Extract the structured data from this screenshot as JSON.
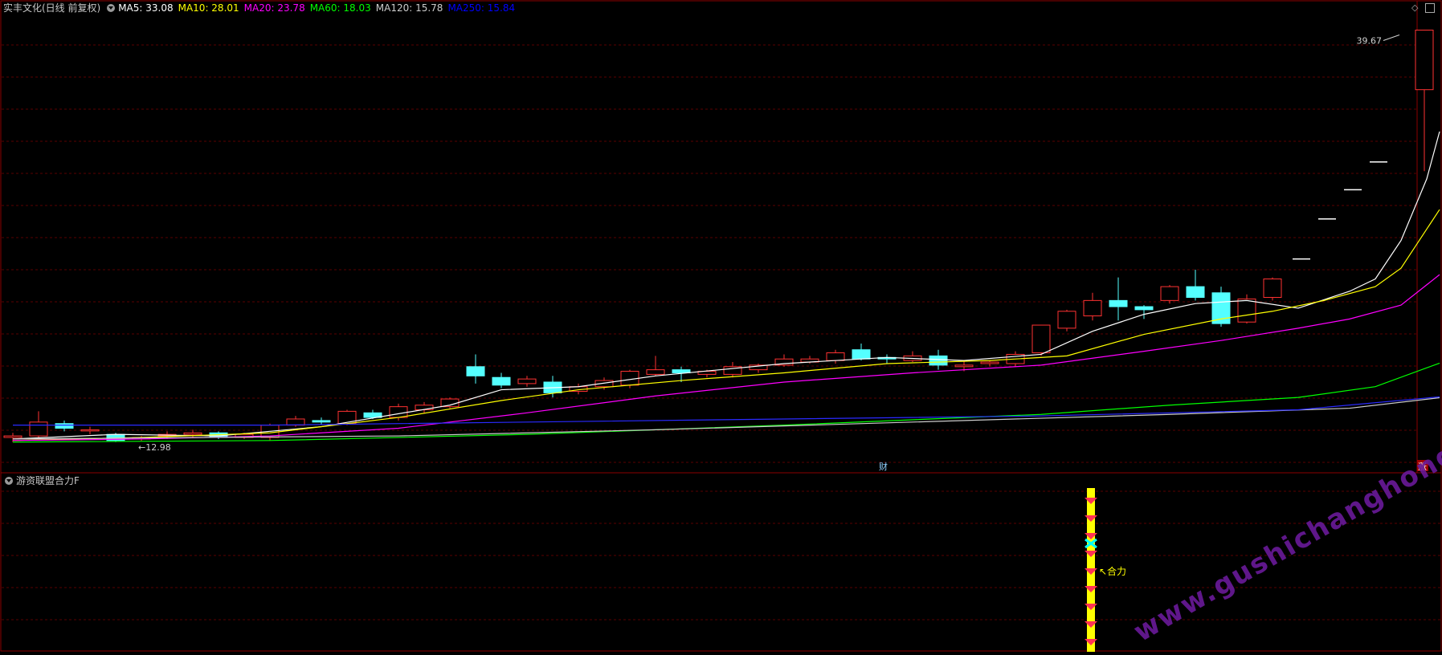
{
  "header": {
    "title": "实丰文化(日线 前复权)",
    "indicators": [
      {
        "label": "MA5: 33.08",
        "color": "#ffffff"
      },
      {
        "label": "MA10: 28.01",
        "color": "#ffff00"
      },
      {
        "label": "MA20: 23.78",
        "color": "#ff00ff"
      },
      {
        "label": "MA60: 18.03",
        "color": "#00ff00"
      },
      {
        "label": "MA120: 15.78",
        "color": "#cccccc"
      },
      {
        "label": "MA250: 15.84",
        "color": "#0000ff"
      }
    ]
  },
  "sub_panel": {
    "title": "游资联盟合力F",
    "signal_label": "↖合力",
    "signal_color": "#ffff00"
  },
  "markers": {
    "finance": "财",
    "rise": "涨"
  },
  "watermark": "www.gushichanghong.com",
  "chart_data": {
    "type": "candlestick",
    "ylim": [
      12.0,
      41.0
    ],
    "high_label": "39.67",
    "low_label": "12.98",
    "candles": [
      [
        13.2,
        13.5,
        12.9,
        13.3
      ],
      [
        13.3,
        14.9,
        13.1,
        14.2
      ],
      [
        14.1,
        14.3,
        13.6,
        13.8
      ],
      [
        13.7,
        13.9,
        13.4,
        13.7
      ],
      [
        13.4,
        13.5,
        12.9,
        13.0
      ],
      [
        13.1,
        13.3,
        12.98,
        13.2
      ],
      [
        13.3,
        13.6,
        13.1,
        13.4
      ],
      [
        13.4,
        13.7,
        13.2,
        13.5
      ],
      [
        13.5,
        13.6,
        13.1,
        13.2
      ],
      [
        13.2,
        13.5,
        13.1,
        13.4
      ],
      [
        13.2,
        14.1,
        13.0,
        14.0
      ],
      [
        14.0,
        14.6,
        13.9,
        14.4
      ],
      [
        14.3,
        14.5,
        14.0,
        14.2
      ],
      [
        14.1,
        15.0,
        14.0,
        14.9
      ],
      [
        14.8,
        15.0,
        14.4,
        14.5
      ],
      [
        14.5,
        15.4,
        14.3,
        15.2
      ],
      [
        15.0,
        15.5,
        14.8,
        15.3
      ],
      [
        15.2,
        15.8,
        15.1,
        15.7
      ],
      [
        17.8,
        18.6,
        16.7,
        17.2
      ],
      [
        17.1,
        17.4,
        16.4,
        16.6
      ],
      [
        16.7,
        17.2,
        16.5,
        17.0
      ],
      [
        16.8,
        17.2,
        15.8,
        16.1
      ],
      [
        16.2,
        16.7,
        16.0,
        16.5
      ],
      [
        16.5,
        17.1,
        16.3,
        16.9
      ],
      [
        16.6,
        17.6,
        16.4,
        17.5
      ],
      [
        17.3,
        18.5,
        17.2,
        17.6
      ],
      [
        17.6,
        17.8,
        16.8,
        17.4
      ],
      [
        17.3,
        17.6,
        17.1,
        17.5
      ],
      [
        17.3,
        18.1,
        17.1,
        17.8
      ],
      [
        17.6,
        18.0,
        17.4,
        17.9
      ],
      [
        17.9,
        18.6,
        17.8,
        18.3
      ],
      [
        18.1,
        18.5,
        18.0,
        18.3
      ],
      [
        18.2,
        18.9,
        18.0,
        18.7
      ],
      [
        18.9,
        19.3,
        18.2,
        18.3
      ],
      [
        18.4,
        18.6,
        18.0,
        18.3
      ],
      [
        18.2,
        18.8,
        18.1,
        18.5
      ],
      [
        18.5,
        18.9,
        17.6,
        17.9
      ],
      [
        17.8,
        18.2,
        17.5,
        17.9
      ],
      [
        18.0,
        18.2,
        17.8,
        18.1
      ],
      [
        18.0,
        18.8,
        17.8,
        18.6
      ],
      [
        18.7,
        20.2,
        18.5,
        20.5
      ],
      [
        20.3,
        21.5,
        20.1,
        21.4
      ],
      [
        21.1,
        22.6,
        20.8,
        22.1
      ],
      [
        22.1,
        23.6,
        20.8,
        21.7
      ],
      [
        21.7,
        21.8,
        20.9,
        21.5
      ],
      [
        22.1,
        23.1,
        21.9,
        23.0
      ],
      [
        23.0,
        24.1,
        22.1,
        22.3
      ],
      [
        22.6,
        23.0,
        20.4,
        20.6
      ],
      [
        20.7,
        22.5,
        20.6,
        22.2
      ],
      [
        22.3,
        23.6,
        22.1,
        23.5
      ]
    ],
    "limit_up_days": [
      24.8,
      27.4,
      29.3,
      31.1
    ],
    "last_candle": [
      30.5,
      39.67,
      30.5,
      35.8
    ],
    "ma_series": [
      {
        "name": "MA5",
        "color": "#ffffff",
        "points": [
          [
            0,
            13.1
          ],
          [
            4,
            13.4
          ],
          [
            8,
            13.3
          ],
          [
            12,
            13.9
          ],
          [
            17,
            15.3
          ],
          [
            19,
            16.3
          ],
          [
            22,
            16.5
          ],
          [
            25,
            17.2
          ],
          [
            30,
            18.0
          ],
          [
            34,
            18.4
          ],
          [
            37,
            18.2
          ],
          [
            40,
            18.6
          ],
          [
            42,
            20.1
          ],
          [
            44,
            21.2
          ],
          [
            46,
            21.9
          ],
          [
            48,
            22.1
          ],
          [
            50,
            21.6
          ],
          [
            52,
            22.7
          ],
          [
            53,
            23.5
          ],
          [
            54,
            26.0
          ],
          [
            55,
            30.0
          ],
          [
            55.5,
            33.08
          ]
        ]
      },
      {
        "name": "MA10",
        "color": "#ffff00",
        "points": [
          [
            0,
            13.0
          ],
          [
            5,
            13.2
          ],
          [
            10,
            13.5
          ],
          [
            15,
            14.5
          ],
          [
            19,
            15.6
          ],
          [
            22,
            16.3
          ],
          [
            26,
            16.9
          ],
          [
            30,
            17.4
          ],
          [
            34,
            18.0
          ],
          [
            38,
            18.2
          ],
          [
            41,
            18.5
          ],
          [
            44,
            19.9
          ],
          [
            47,
            20.9
          ],
          [
            49,
            21.4
          ],
          [
            51,
            22.1
          ],
          [
            53,
            23.0
          ],
          [
            54,
            24.2
          ],
          [
            55.5,
            28.01
          ]
        ]
      },
      {
        "name": "MA20",
        "color": "#ff00ff",
        "points": [
          [
            0,
            13.0
          ],
          [
            5,
            13.1
          ],
          [
            10,
            13.3
          ],
          [
            15,
            13.8
          ],
          [
            20,
            14.8
          ],
          [
            25,
            15.9
          ],
          [
            30,
            16.8
          ],
          [
            35,
            17.4
          ],
          [
            40,
            17.9
          ],
          [
            44,
            18.8
          ],
          [
            47,
            19.5
          ],
          [
            50,
            20.3
          ],
          [
            52,
            20.9
          ],
          [
            54,
            21.8
          ],
          [
            55.5,
            23.78
          ]
        ]
      },
      {
        "name": "MA60",
        "color": "#00ff00",
        "points": [
          [
            0,
            12.9
          ],
          [
            10,
            13.0
          ],
          [
            20,
            13.4
          ],
          [
            30,
            14.0
          ],
          [
            40,
            14.7
          ],
          [
            45,
            15.3
          ],
          [
            50,
            15.8
          ],
          [
            53,
            16.5
          ],
          [
            55.5,
            18.03
          ]
        ]
      },
      {
        "name": "MA120",
        "color": "#cccccc",
        "points": [
          [
            0,
            13.1
          ],
          [
            15,
            13.3
          ],
          [
            25,
            13.7
          ],
          [
            35,
            14.2
          ],
          [
            45,
            14.7
          ],
          [
            52,
            15.1
          ],
          [
            55.5,
            15.78
          ]
        ]
      },
      {
        "name": "MA250",
        "color": "#2a2aff",
        "points": [
          [
            0,
            14.0
          ],
          [
            10,
            14.0
          ],
          [
            20,
            14.2
          ],
          [
            30,
            14.4
          ],
          [
            40,
            14.6
          ],
          [
            50,
            15.0
          ],
          [
            55.5,
            15.84
          ]
        ]
      }
    ]
  }
}
